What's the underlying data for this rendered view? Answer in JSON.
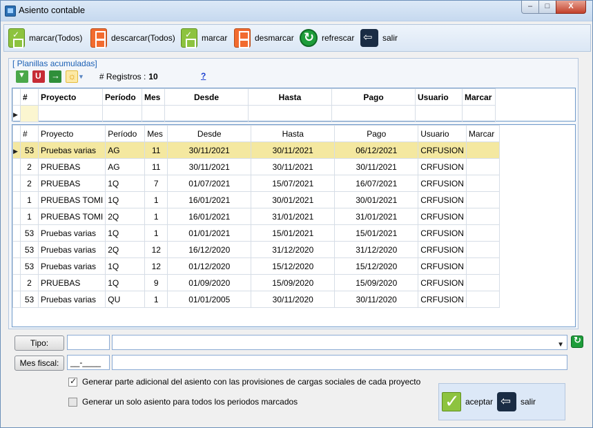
{
  "window": {
    "title": "Asiento contable",
    "min": "–",
    "max": "□",
    "close": "X"
  },
  "toolbar": {
    "mark_all": "marcar(Todos)",
    "unmark_all": "descarcar(Todos)",
    "mark": "marcar",
    "unmark": "desmarcar",
    "refresh": "refrescar",
    "exit": "salir"
  },
  "group": {
    "title": "[ Planillas acumuladas]",
    "registros_label": "# Registros :",
    "registros_count": "10",
    "help": "?"
  },
  "columns": [
    "#",
    "Proyecto",
    "Período",
    "Mes",
    "Desde",
    "Hasta",
    "Pago",
    "Usuario",
    "Marcar"
  ],
  "rows": [
    {
      "num": "53",
      "proyecto": "Pruebas varias",
      "periodo": "AG",
      "mes": "11",
      "desde": "30/11/2021",
      "hasta": "30/11/2021",
      "pago": "06/12/2021",
      "usuario": "CRFUSION",
      "marcar": ""
    },
    {
      "num": "2",
      "proyecto": "PRUEBAS",
      "periodo": "AG",
      "mes": "11",
      "desde": "30/11/2021",
      "hasta": "30/11/2021",
      "pago": "30/11/2021",
      "usuario": "CRFUSION",
      "marcar": ""
    },
    {
      "num": "2",
      "proyecto": "PRUEBAS",
      "periodo": "1Q",
      "mes": "7",
      "desde": "01/07/2021",
      "hasta": "15/07/2021",
      "pago": "16/07/2021",
      "usuario": "CRFUSION",
      "marcar": ""
    },
    {
      "num": "1",
      "proyecto": "PRUEBAS TOMI",
      "periodo": "1Q",
      "mes": "1",
      "desde": "16/01/2021",
      "hasta": "30/01/2021",
      "pago": "30/01/2021",
      "usuario": "CRFUSION",
      "marcar": ""
    },
    {
      "num": "1",
      "proyecto": "PRUEBAS TOMI",
      "periodo": "2Q",
      "mes": "1",
      "desde": "16/01/2021",
      "hasta": "31/01/2021",
      "pago": "31/01/2021",
      "usuario": "CRFUSION",
      "marcar": ""
    },
    {
      "num": "53",
      "proyecto": "Pruebas varias",
      "periodo": "1Q",
      "mes": "1",
      "desde": "01/01/2021",
      "hasta": "15/01/2021",
      "pago": "15/01/2021",
      "usuario": "CRFUSION",
      "marcar": ""
    },
    {
      "num": "53",
      "proyecto": "Pruebas varias",
      "periodo": "2Q",
      "mes": "12",
      "desde": "16/12/2020",
      "hasta": "31/12/2020",
      "pago": "31/12/2020",
      "usuario": "CRFUSION",
      "marcar": ""
    },
    {
      "num": "53",
      "proyecto": "Pruebas varias",
      "periodo": "1Q",
      "mes": "12",
      "desde": "01/12/2020",
      "hasta": "15/12/2020",
      "pago": "15/12/2020",
      "usuario": "CRFUSION",
      "marcar": ""
    },
    {
      "num": "2",
      "proyecto": "PRUEBAS",
      "periodo": "1Q",
      "mes": "9",
      "desde": "01/09/2020",
      "hasta": "15/09/2020",
      "pago": "15/09/2020",
      "usuario": "CRFUSION",
      "marcar": ""
    },
    {
      "num": "53",
      "proyecto": "Pruebas varias",
      "periodo": "QU",
      "mes": "1",
      "desde": "01/01/2005",
      "hasta": "30/11/2020",
      "pago": "30/11/2020",
      "usuario": "CRFUSION",
      "marcar": ""
    }
  ],
  "form": {
    "tipo_label": "Tipo:",
    "tipo_code": "",
    "tipo_value": "",
    "mes_label": "Mes fiscal:",
    "mes_value": "__-____",
    "mes_desc": ""
  },
  "options": {
    "opt1_label": "Generar parte adicional del asiento con las provisiones de cargas sociales de cada proyecto",
    "opt1_checked": true,
    "opt2_label": "Generar un solo asiento para todos los periodos marcados",
    "opt2_checked": false
  },
  "actions": {
    "accept": "aceptar",
    "exit": "salir"
  }
}
